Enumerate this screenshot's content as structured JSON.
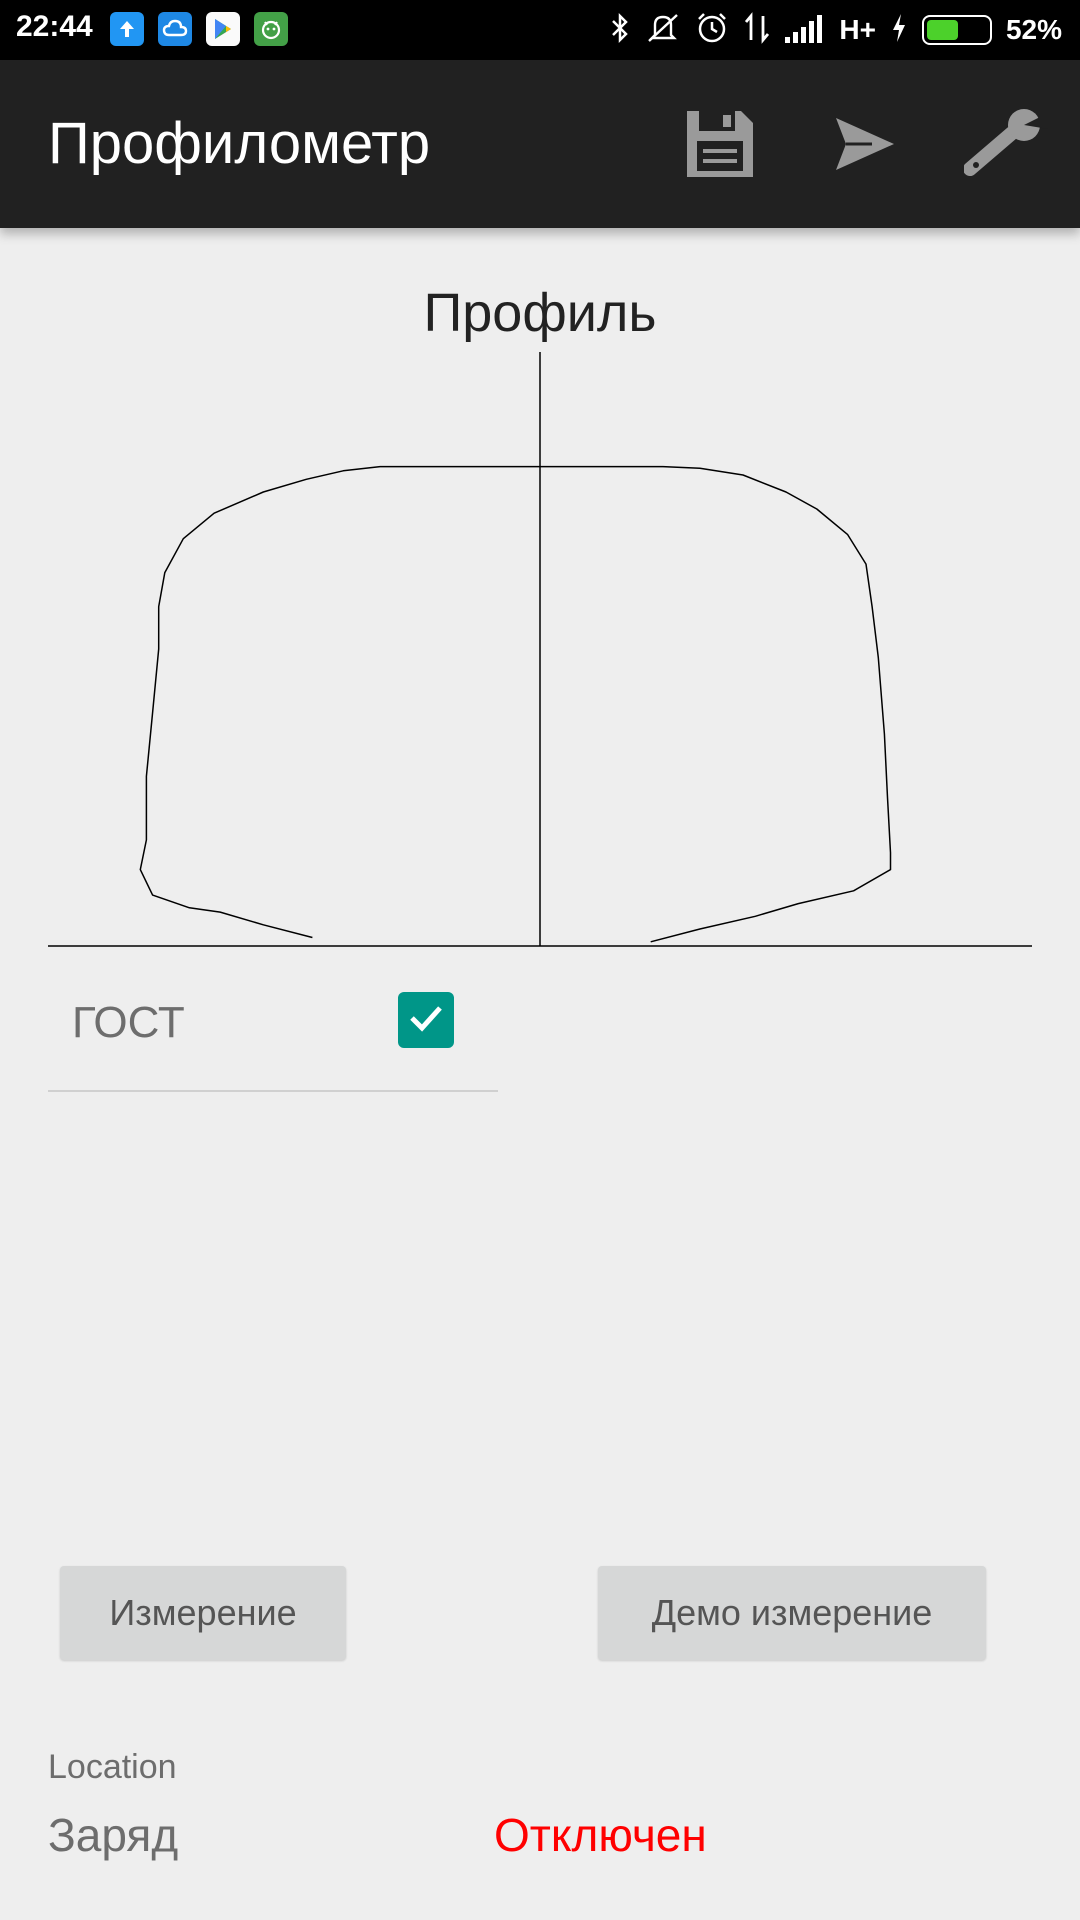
{
  "status_bar": {
    "time": "22:44",
    "network": "H+",
    "battery_percent": "52%",
    "battery_level": 0.52,
    "notification_icons": [
      "upload-icon",
      "cloud-icon",
      "play-store-icon",
      "android-app-icon"
    ],
    "system_icons": [
      "bluetooth-icon",
      "vibrate-off-icon",
      "alarm-icon",
      "data-arrows-icon",
      "signal-icon",
      "charging-icon"
    ]
  },
  "app_bar": {
    "title": "Профилометр",
    "actions": [
      "save-icon",
      "send-icon",
      "settings-wrench-icon"
    ]
  },
  "chart_data": {
    "type": "line",
    "title": "Профиль",
    "grid": false,
    "legend": "none",
    "series": [
      {
        "points": [
          [
            -37,
            2
          ],
          [
            -45,
            5
          ],
          [
            -52,
            8
          ],
          [
            -57,
            9
          ],
          [
            -63,
            12
          ],
          [
            -65,
            18
          ],
          [
            -64,
            25
          ],
          [
            -64,
            40
          ],
          [
            -63,
            55
          ],
          [
            -62,
            70
          ],
          [
            -62,
            80
          ],
          [
            -61,
            88
          ],
          [
            -58,
            96
          ],
          [
            -53,
            102
          ],
          [
            -45,
            107
          ],
          [
            -38,
            110
          ],
          [
            -32,
            112
          ],
          [
            -26,
            113
          ],
          [
            -20,
            113
          ],
          [
            0,
            113
          ],
          [
            20,
            113
          ],
          [
            26,
            112.6
          ],
          [
            33,
            111
          ],
          [
            40,
            107
          ],
          [
            45,
            103
          ],
          [
            50,
            97
          ],
          [
            53,
            90
          ],
          [
            54,
            80
          ],
          [
            55,
            68
          ],
          [
            56,
            50
          ],
          [
            56.5,
            35
          ],
          [
            57,
            22
          ],
          [
            57,
            18
          ],
          [
            51,
            13
          ],
          [
            42,
            10
          ],
          [
            35,
            7
          ],
          [
            26,
            4
          ],
          [
            18,
            1
          ]
        ]
      }
    ],
    "xlim": [
      -80,
      80
    ],
    "ylim": [
      0,
      140
    ]
  },
  "gost": {
    "label": "ГОСТ",
    "checked": true
  },
  "buttons": {
    "measure": "Измерение",
    "demo": "Демо измерение"
  },
  "footer": {
    "location_label": "Location",
    "charge_label": "Заряд",
    "connection_status": "Отключен",
    "connection_status_color": "#ff0000"
  },
  "colors": {
    "accent": "#009688",
    "app_bar": "#212121",
    "background": "#eeeeee"
  }
}
